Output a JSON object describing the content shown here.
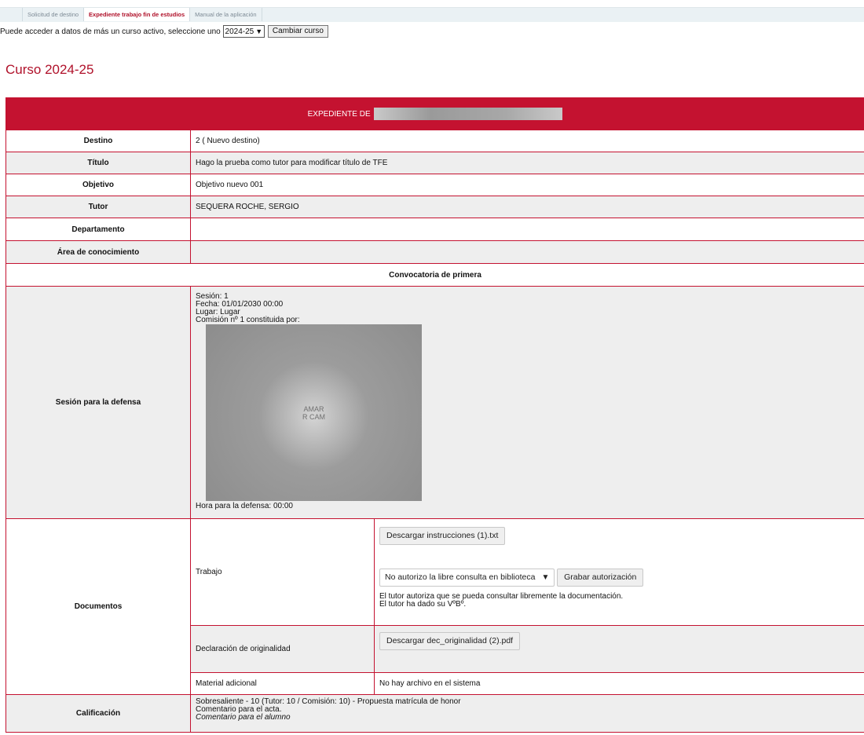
{
  "tabs": [
    {
      "label": "Solicitud de destino",
      "active": false
    },
    {
      "label": "Expediente trabajo fin de estudios",
      "active": true
    },
    {
      "label": "Manual de la aplicación",
      "active": false
    }
  ],
  "course_selector": {
    "prompt": "Puede acceder a datos de más un curso activo, seleccione uno",
    "selected": "2024-25",
    "button": "Cambiar curso"
  },
  "course_title": "Curso 2024-25",
  "expediente": {
    "header_prefix": "EXPEDIENTE DE",
    "rows": {
      "destino": {
        "label": "Destino",
        "value": "2 ( Nuevo destino)"
      },
      "titulo": {
        "label": "Título",
        "value": "Hago la prueba como tutor para modificar título de TFE"
      },
      "objetivo": {
        "label": "Objetivo",
        "value": "Objetivo nuevo 001"
      },
      "tutor": {
        "label": "Tutor",
        "value": "SEQUERA ROCHE, SERGIO"
      },
      "departamento": {
        "label": "Departamento",
        "value": ""
      },
      "area": {
        "label": "Área de conocimiento",
        "value": ""
      }
    },
    "convocatoria": "Convocatoria de primera",
    "sesion": {
      "label": "Sesión para la defensa",
      "lines": [
        "Sesión: 1",
        "Fecha: 01/01/2030 00:00",
        "Lugar: Lugar",
        "Comisión nº 1 constituida por:"
      ],
      "hora": "Hora para la defensa: 00:00"
    },
    "documentos": {
      "label": "Documentos",
      "trabajo": {
        "label": "Trabajo",
        "download_button": "Descargar instrucciones (1).txt",
        "select_value": "No autorizo la libre consulta en biblioteca",
        "save_button": "Grabar autorización",
        "note_1": "El tutor autoriza que se pueda consultar libremente la documentación.",
        "note_2": "El tutor ha dado su VºBº."
      },
      "originalidad": {
        "label": "Declaración de originalidad",
        "download_button": "Descargar dec_originalidad (2).pdf"
      },
      "material": {
        "label": "Material adicional",
        "value": "No hay archivo en el sistema"
      }
    },
    "calificacion": {
      "label": "Calificación",
      "line_1": "Sobresaliente - 10 (Tutor: 10 / Comisión: 10) - Propuesta matrícula de honor",
      "line_2": "Comentario para el acta.",
      "line_3": "Comentario para el alumno"
    }
  }
}
